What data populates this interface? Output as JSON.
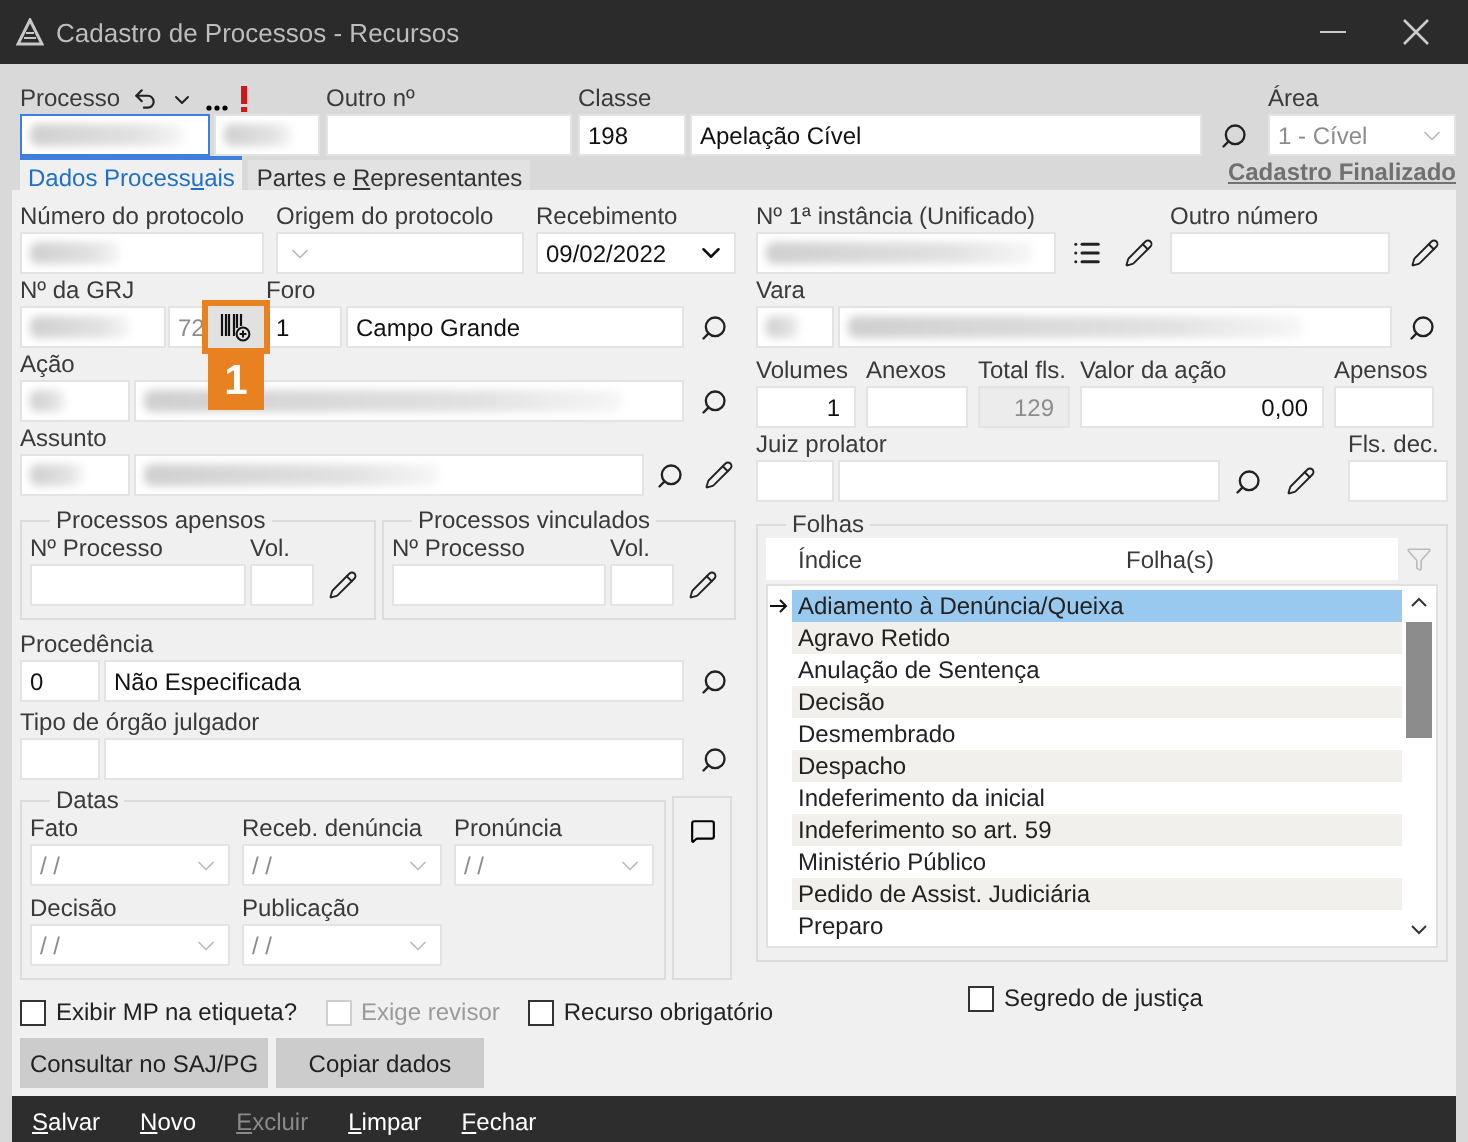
{
  "window": {
    "title": "Cadastro de Processos - Recursos"
  },
  "header": {
    "processo": {
      "label": "Processo",
      "redacted": true
    },
    "outro": {
      "label": "Outro nº"
    },
    "classe": {
      "label": "Classe",
      "code": "198",
      "name": "Apelação Cível"
    },
    "area": {
      "label": "Área",
      "value": "1 - Cível",
      "disabled": true
    }
  },
  "tabs": [
    {
      "before": "Dados Process",
      "key": "u",
      "after": "ais",
      "selected": true
    },
    {
      "before": "Partes e ",
      "key": "R",
      "after": "epresentantes",
      "selected": false
    }
  ],
  "status_link": "Cadastro Finalizado",
  "protocol": [
    {
      "label": "Número do protocolo",
      "kind": "text",
      "redacted": true
    },
    {
      "label": "Origem do protocolo",
      "kind": "select"
    },
    {
      "label": "Recebimento",
      "kind": "date",
      "value": "09/02/2022"
    }
  ],
  "grj": {
    "label": "Nº da GRJ",
    "redacted": true,
    "suffix": "72"
  },
  "callout": {
    "text": "1"
  },
  "foro": {
    "label": "Foro",
    "code": "1",
    "name": "Campo Grande"
  },
  "acao": {
    "label": "Ação",
    "redacted": true
  },
  "assunto": {
    "label": "Assunto",
    "redacted": true
  },
  "groups": [
    {
      "title": "Processos apensos",
      "columns": [
        "Nº Processo",
        "Vol."
      ]
    },
    {
      "title": "Processos vinculados",
      "columns": [
        "Nº Processo",
        "Vol."
      ]
    }
  ],
  "procedencia": {
    "label": "Procedência",
    "code": "0",
    "name": "Não Especificada"
  },
  "tipo_orgao": {
    "label": "Tipo de órgão julgador"
  },
  "datas": {
    "title": "Datas",
    "fields": [
      {
        "label": "Fato",
        "value": "/ /"
      },
      {
        "label": "Receb. denúncia",
        "value": "/ /"
      },
      {
        "label": "Pronúncia",
        "value": "/ /"
      },
      {
        "label": "Decisão",
        "value": "/ /"
      },
      {
        "label": "Publicação",
        "value": "/ /"
      }
    ]
  },
  "instancia": {
    "label": "Nº 1ª instância (Unificado)",
    "redacted": true
  },
  "outro_numero": {
    "label": "Outro número"
  },
  "vara": {
    "label": "Vara",
    "redacted": true
  },
  "numbers": [
    {
      "label": "Volumes",
      "value": "1",
      "disabled": false
    },
    {
      "label": "Anexos",
      "disabled": false
    },
    {
      "label": "Total fls.",
      "value": "129",
      "disabled": true
    },
    {
      "label": "Valor da ação",
      "value": "0,00",
      "disabled": false
    },
    {
      "label": "Apensos",
      "disabled": false
    }
  ],
  "juiz": {
    "label": "Juiz prolator"
  },
  "fls_dec": {
    "label": "Fls. dec."
  },
  "folhas": {
    "title": "Folhas",
    "columns": [
      "Índice",
      "Folha(s)"
    ],
    "rows": [
      {
        "label": "Adiamento à Denúncia/Queixa",
        "selected": true
      },
      {
        "label": "Agravo Retido",
        "selected": false
      },
      {
        "label": "Anulação de Sentença",
        "selected": false
      },
      {
        "label": "Decisão",
        "selected": false
      },
      {
        "label": "Desmembrado",
        "selected": false
      },
      {
        "label": "Despacho",
        "selected": false
      },
      {
        "label": "Indeferimento da inicial",
        "selected": false
      },
      {
        "label": "Indeferimento so art. 59",
        "selected": false
      },
      {
        "label": "Ministério Público",
        "selected": false
      },
      {
        "label": "Pedido de Assist. Judiciária",
        "selected": false
      },
      {
        "label": "Preparo",
        "selected": false
      }
    ]
  },
  "options": [
    {
      "label": "Exibir MP na etiqueta?",
      "checked": false,
      "disabled": false
    },
    {
      "label": "Exige revisor",
      "checked": false,
      "disabled": true
    },
    {
      "label": "Recurso obrigatório",
      "checked": false,
      "disabled": false
    },
    {
      "label": "Segredo de justiça",
      "checked": false,
      "disabled": false
    }
  ],
  "buttons": [
    "Consultar no SAJ/PG",
    "Copiar dados"
  ],
  "menu": [
    {
      "key": "S",
      "after": "alvar",
      "disabled": false
    },
    {
      "key": "N",
      "after": "ovo",
      "disabled": false
    },
    {
      "key": "E",
      "after": "xcluir",
      "disabled": true
    },
    {
      "key": "L",
      "after": "impar",
      "disabled": false
    },
    {
      "key": "F",
      "after": "echar",
      "disabled": false
    }
  ]
}
